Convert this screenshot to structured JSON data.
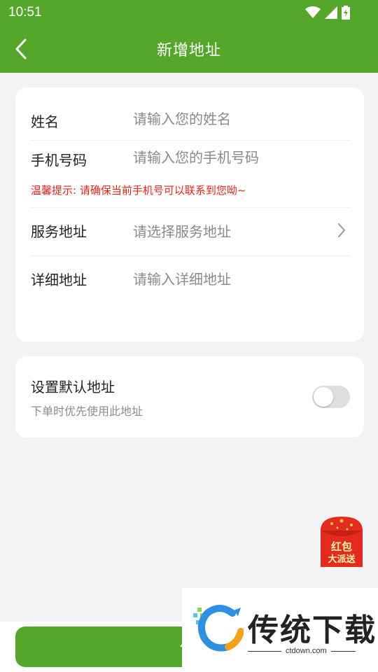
{
  "status_bar": {
    "time": "10:51"
  },
  "app_bar": {
    "title": "新增地址"
  },
  "form": {
    "name": {
      "label": "姓名",
      "placeholder": "请输入您的姓名"
    },
    "phone": {
      "label": "手机号码",
      "placeholder": "请输入您的手机号码"
    },
    "tip": "温馨提示: 请确保当前手机号可以联系到您呦~",
    "service_address": {
      "label": "服务地址",
      "placeholder": "请选择服务地址"
    },
    "detail_address": {
      "label": "详细地址",
      "placeholder": "请输入详细地址"
    }
  },
  "default_address": {
    "title": "设置默认地址",
    "subtitle": "下单时优先使用此地址",
    "enabled": false
  },
  "red_packet": {
    "line1": "红包",
    "line2": "大派送"
  },
  "save_button": {
    "label": "保"
  },
  "watermark": {
    "brand": "传统下载",
    "url": "ctdown.com"
  },
  "colors": {
    "primary": "#54a72b",
    "tip": "#e0241a",
    "card": "#ffffff",
    "background": "#f3f3f3"
  }
}
